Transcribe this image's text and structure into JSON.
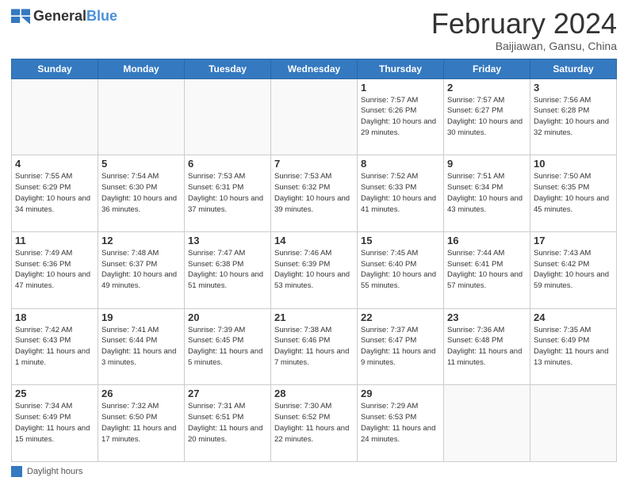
{
  "header": {
    "logo_general": "General",
    "logo_blue": "Blue",
    "month_title": "February 2024",
    "location": "Baijiawan, Gansu, China"
  },
  "days_of_week": [
    "Sunday",
    "Monday",
    "Tuesday",
    "Wednesday",
    "Thursday",
    "Friday",
    "Saturday"
  ],
  "weeks": [
    [
      {
        "day": "",
        "info": ""
      },
      {
        "day": "",
        "info": ""
      },
      {
        "day": "",
        "info": ""
      },
      {
        "day": "",
        "info": ""
      },
      {
        "day": "1",
        "info": "Sunrise: 7:57 AM\nSunset: 6:26 PM\nDaylight: 10 hours and 29 minutes."
      },
      {
        "day": "2",
        "info": "Sunrise: 7:57 AM\nSunset: 6:27 PM\nDaylight: 10 hours and 30 minutes."
      },
      {
        "day": "3",
        "info": "Sunrise: 7:56 AM\nSunset: 6:28 PM\nDaylight: 10 hours and 32 minutes."
      }
    ],
    [
      {
        "day": "4",
        "info": "Sunrise: 7:55 AM\nSunset: 6:29 PM\nDaylight: 10 hours and 34 minutes."
      },
      {
        "day": "5",
        "info": "Sunrise: 7:54 AM\nSunset: 6:30 PM\nDaylight: 10 hours and 36 minutes."
      },
      {
        "day": "6",
        "info": "Sunrise: 7:53 AM\nSunset: 6:31 PM\nDaylight: 10 hours and 37 minutes."
      },
      {
        "day": "7",
        "info": "Sunrise: 7:53 AM\nSunset: 6:32 PM\nDaylight: 10 hours and 39 minutes."
      },
      {
        "day": "8",
        "info": "Sunrise: 7:52 AM\nSunset: 6:33 PM\nDaylight: 10 hours and 41 minutes."
      },
      {
        "day": "9",
        "info": "Sunrise: 7:51 AM\nSunset: 6:34 PM\nDaylight: 10 hours and 43 minutes."
      },
      {
        "day": "10",
        "info": "Sunrise: 7:50 AM\nSunset: 6:35 PM\nDaylight: 10 hours and 45 minutes."
      }
    ],
    [
      {
        "day": "11",
        "info": "Sunrise: 7:49 AM\nSunset: 6:36 PM\nDaylight: 10 hours and 47 minutes."
      },
      {
        "day": "12",
        "info": "Sunrise: 7:48 AM\nSunset: 6:37 PM\nDaylight: 10 hours and 49 minutes."
      },
      {
        "day": "13",
        "info": "Sunrise: 7:47 AM\nSunset: 6:38 PM\nDaylight: 10 hours and 51 minutes."
      },
      {
        "day": "14",
        "info": "Sunrise: 7:46 AM\nSunset: 6:39 PM\nDaylight: 10 hours and 53 minutes."
      },
      {
        "day": "15",
        "info": "Sunrise: 7:45 AM\nSunset: 6:40 PM\nDaylight: 10 hours and 55 minutes."
      },
      {
        "day": "16",
        "info": "Sunrise: 7:44 AM\nSunset: 6:41 PM\nDaylight: 10 hours and 57 minutes."
      },
      {
        "day": "17",
        "info": "Sunrise: 7:43 AM\nSunset: 6:42 PM\nDaylight: 10 hours and 59 minutes."
      }
    ],
    [
      {
        "day": "18",
        "info": "Sunrise: 7:42 AM\nSunset: 6:43 PM\nDaylight: 11 hours and 1 minute."
      },
      {
        "day": "19",
        "info": "Sunrise: 7:41 AM\nSunset: 6:44 PM\nDaylight: 11 hours and 3 minutes."
      },
      {
        "day": "20",
        "info": "Sunrise: 7:39 AM\nSunset: 6:45 PM\nDaylight: 11 hours and 5 minutes."
      },
      {
        "day": "21",
        "info": "Sunrise: 7:38 AM\nSunset: 6:46 PM\nDaylight: 11 hours and 7 minutes."
      },
      {
        "day": "22",
        "info": "Sunrise: 7:37 AM\nSunset: 6:47 PM\nDaylight: 11 hours and 9 minutes."
      },
      {
        "day": "23",
        "info": "Sunrise: 7:36 AM\nSunset: 6:48 PM\nDaylight: 11 hours and 11 minutes."
      },
      {
        "day": "24",
        "info": "Sunrise: 7:35 AM\nSunset: 6:49 PM\nDaylight: 11 hours and 13 minutes."
      }
    ],
    [
      {
        "day": "25",
        "info": "Sunrise: 7:34 AM\nSunset: 6:49 PM\nDaylight: 11 hours and 15 minutes."
      },
      {
        "day": "26",
        "info": "Sunrise: 7:32 AM\nSunset: 6:50 PM\nDaylight: 11 hours and 17 minutes."
      },
      {
        "day": "27",
        "info": "Sunrise: 7:31 AM\nSunset: 6:51 PM\nDaylight: 11 hours and 20 minutes."
      },
      {
        "day": "28",
        "info": "Sunrise: 7:30 AM\nSunset: 6:52 PM\nDaylight: 11 hours and 22 minutes."
      },
      {
        "day": "29",
        "info": "Sunrise: 7:29 AM\nSunset: 6:53 PM\nDaylight: 11 hours and 24 minutes."
      },
      {
        "day": "",
        "info": ""
      },
      {
        "day": "",
        "info": ""
      }
    ]
  ],
  "legend": {
    "box_label": "Daylight hours"
  }
}
